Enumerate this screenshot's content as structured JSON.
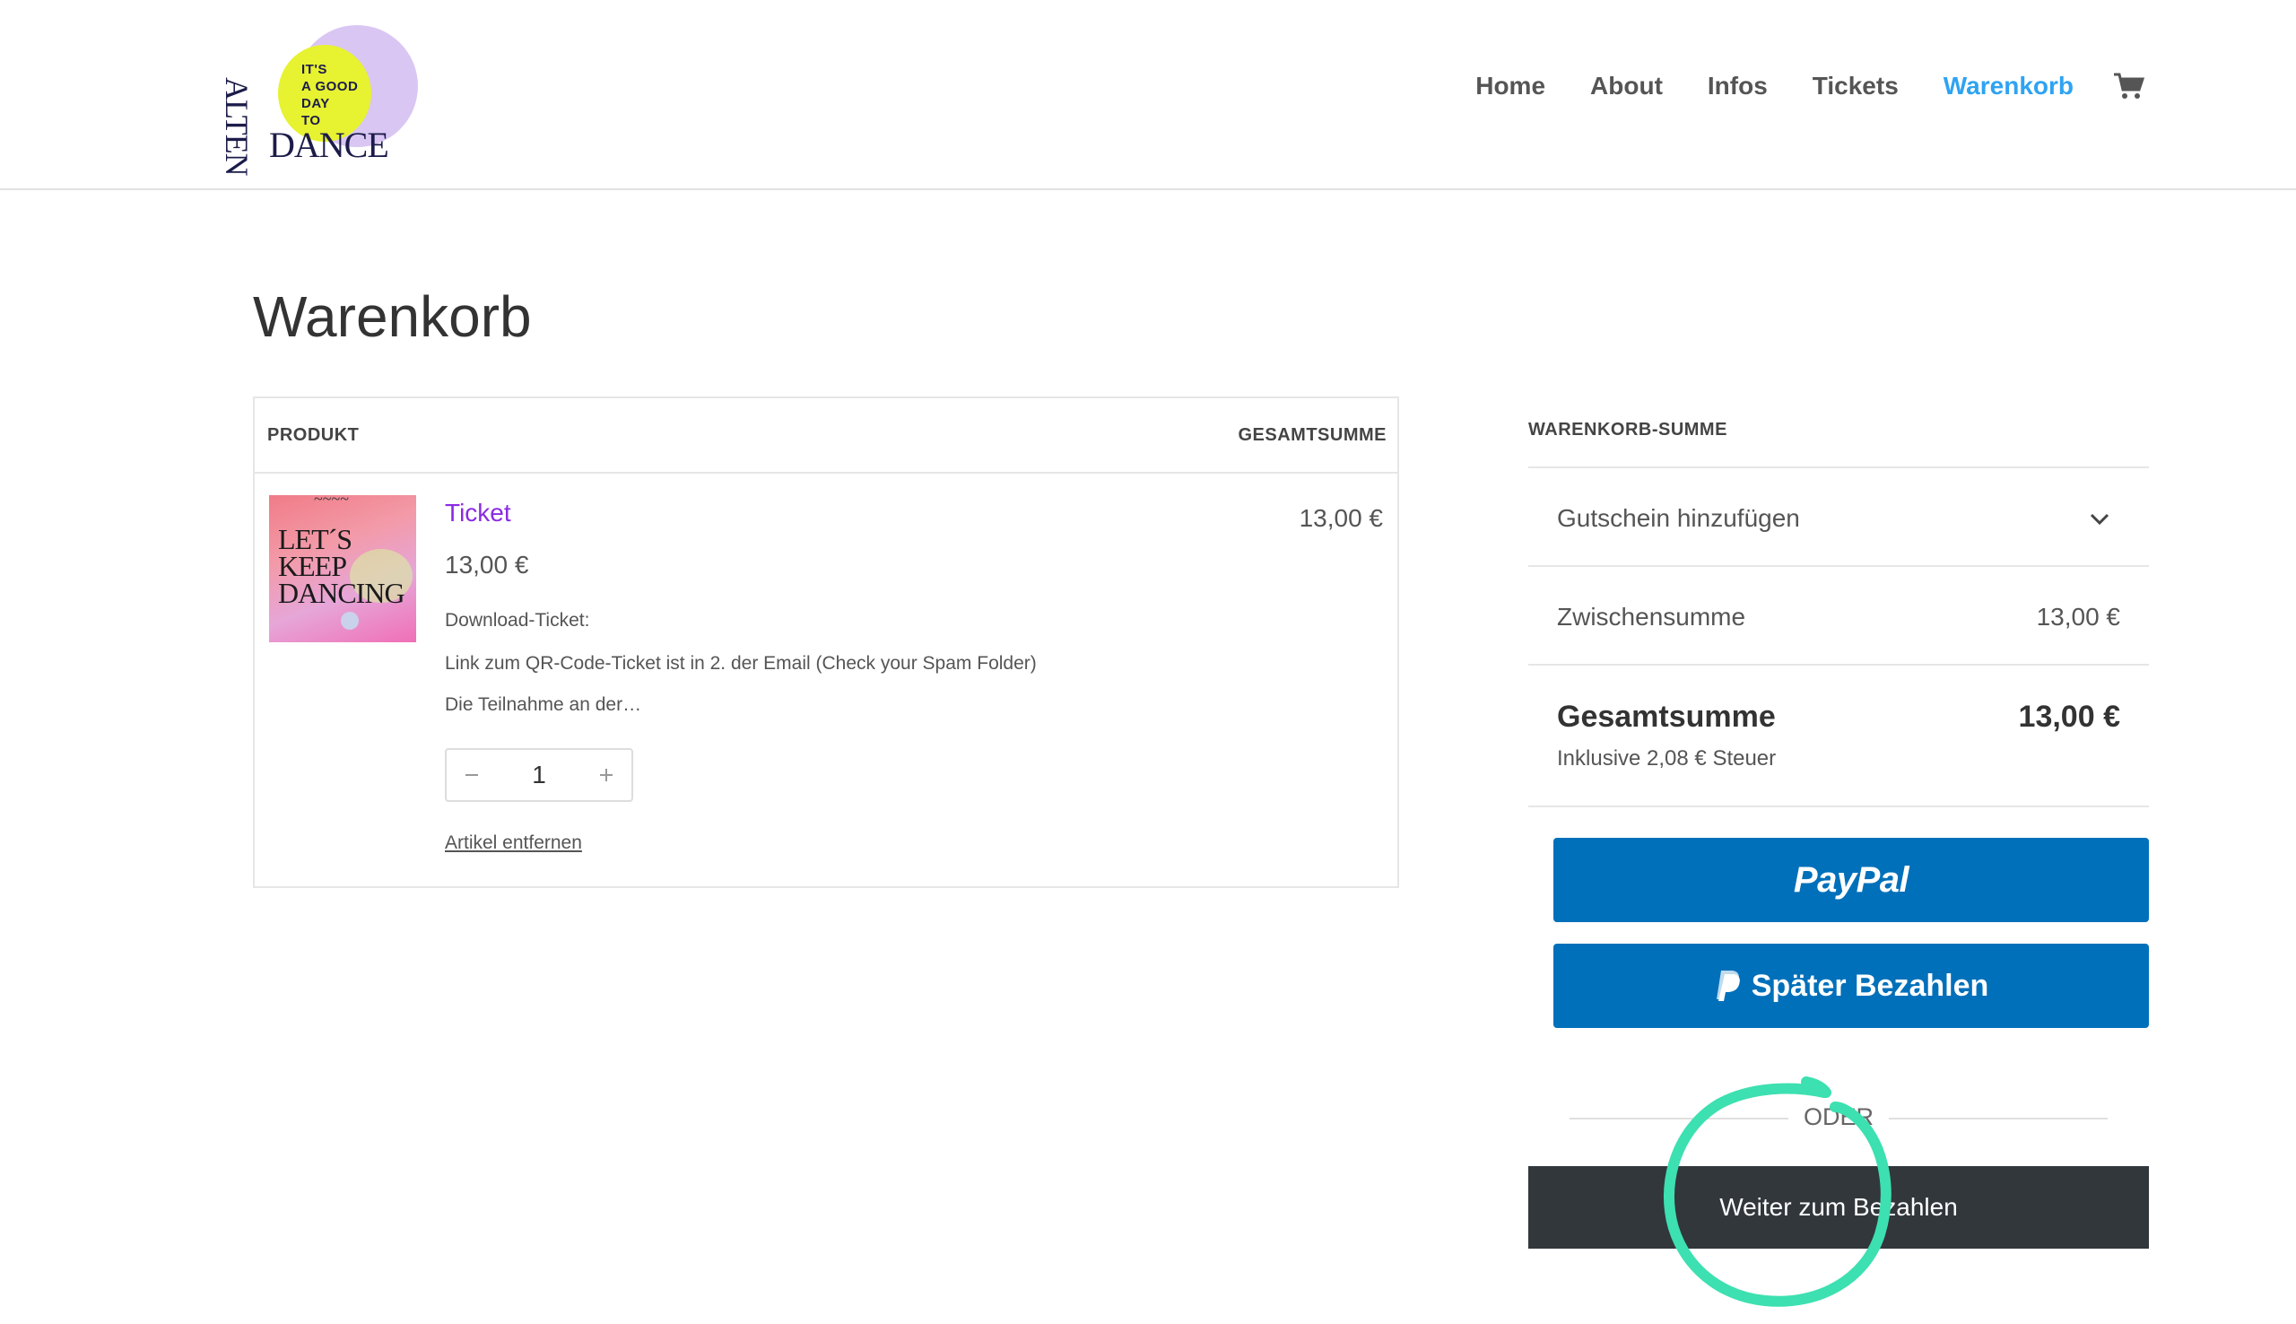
{
  "header": {
    "logo": {
      "tagline_lines": [
        "IT'S",
        "A GOOD",
        "DAY",
        "TO"
      ],
      "dance": "DANCE",
      "vertical": "ALTEN"
    },
    "nav": [
      {
        "label": "Home",
        "active": false
      },
      {
        "label": "About",
        "active": false
      },
      {
        "label": "Infos",
        "active": false
      },
      {
        "label": "Tickets",
        "active": false
      },
      {
        "label": "Warenkorb",
        "active": true
      }
    ],
    "cart_icon": "cart-icon"
  },
  "page": {
    "title": "Warenkorb"
  },
  "cart": {
    "columns": {
      "product": "PRODUKT",
      "total": "GESAMTSUMME"
    },
    "item": {
      "thumbnail_text": "LET´S KEEP DANCING",
      "name": "Ticket",
      "price": "13,00 €",
      "description": [
        "Download-Ticket:",
        "Link zum QR-Code-Ticket ist in 2. der Email (Check your Spam Folder)",
        "Die Teilnahme an der…"
      ],
      "quantity": "1",
      "total": "13,00 €",
      "remove_label": "Artikel entfernen"
    }
  },
  "totals": {
    "title": "WARENKORB-SUMME",
    "coupon_label": "Gutschein hinzufügen",
    "subtotal_label": "Zwischensumme",
    "subtotal_value": "13,00 €",
    "grand_label": "Gesamtsumme",
    "grand_value": "13,00 €",
    "tax_note": "Inklusive 2,08 € Steuer",
    "paypal_label": "PayPal",
    "paylater_label": "Später Bezahlen",
    "or_label": "ODER",
    "checkout_label": "Weiter zum Bezahlen"
  },
  "colors": {
    "accent_nav": "#2ea3f2",
    "product_link": "#8a2be2",
    "paypal_blue": "#0070ba",
    "checkout_dark": "#32373c",
    "highlight": "#3de0b0"
  }
}
